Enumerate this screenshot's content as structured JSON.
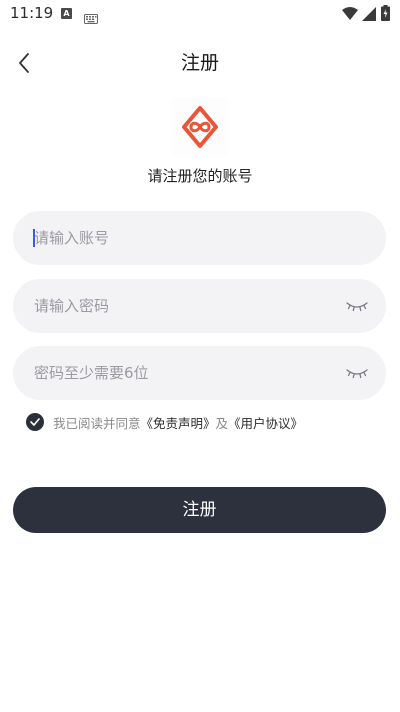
{
  "status_bar": {
    "time": "11:19",
    "indicator_letter": "A"
  },
  "header": {
    "title": "注册"
  },
  "subtitle": "请注册您的账号",
  "form": {
    "account_placeholder": "请输入账号",
    "password_placeholder": "请输入密码",
    "confirm_placeholder": "密码至少需要6位"
  },
  "agreement": {
    "checked": true,
    "prefix": "我已阅读并同意",
    "disclaimer_link": "《免责声明》",
    "connector": "及",
    "terms_link": "《用户协议》"
  },
  "submit_label": "注册",
  "colors": {
    "primary_dark": "#2c313d",
    "field_bg": "#f3f3f6",
    "logo_accent": "#e8563a",
    "caret": "#3b5bdb"
  },
  "icons": {
    "back": "chevron-left-icon",
    "logo": "infinity-diamond-logo-icon",
    "eye": "eye-closed-icon",
    "check": "check-icon"
  }
}
